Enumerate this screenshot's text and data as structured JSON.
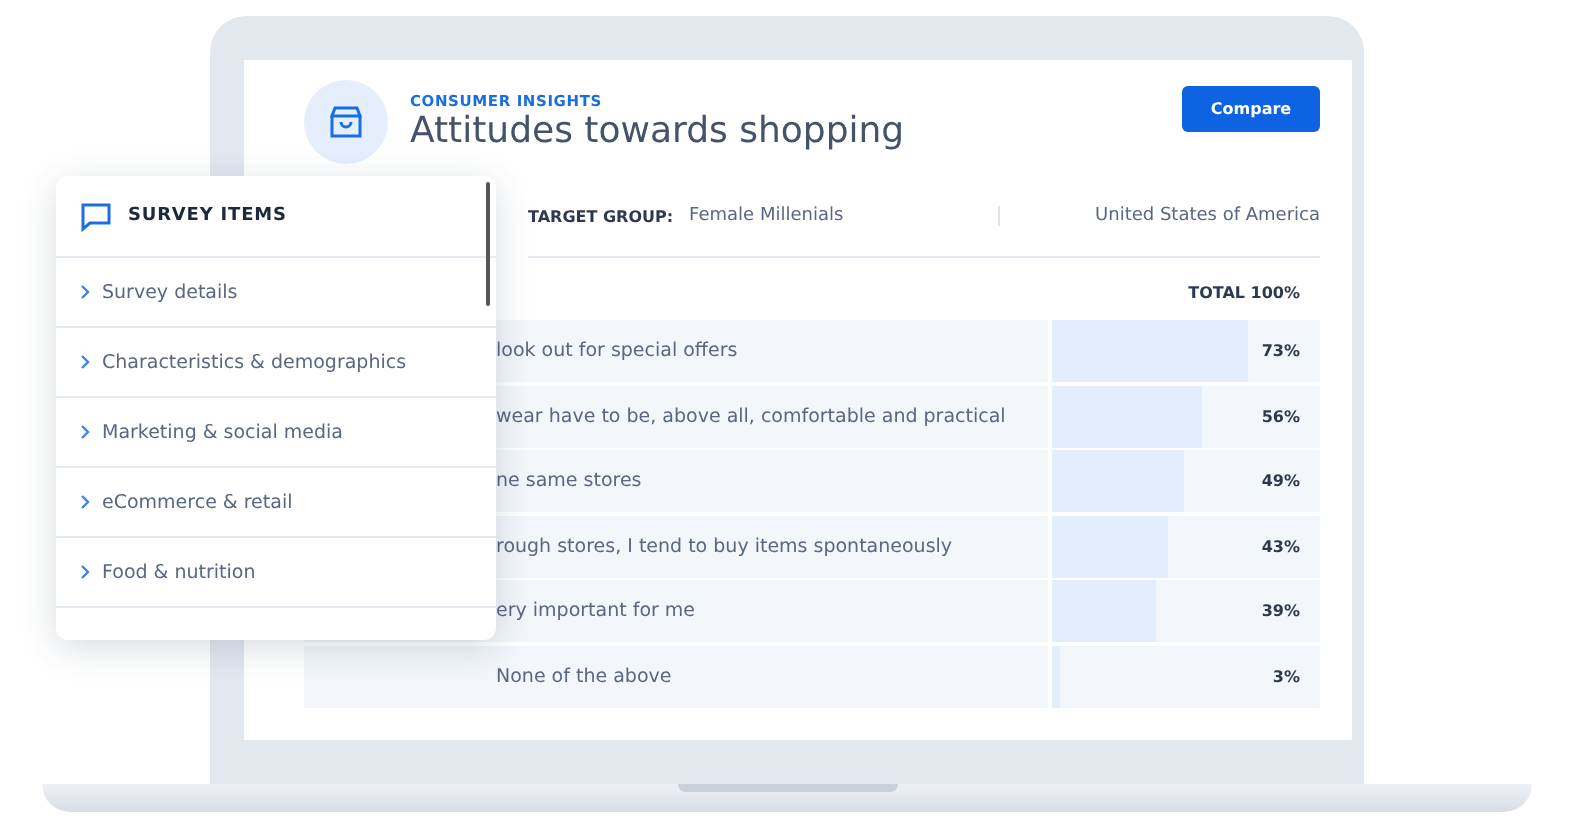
{
  "header": {
    "eyebrow": "CONSUMER INSIGHTS",
    "title": "Attitudes towards shopping",
    "button": "Compare"
  },
  "filters": {
    "label": "TARGET GROUP:",
    "value": "Female Millenials",
    "country": "United States of America"
  },
  "table": {
    "total": "TOTAL 100%",
    "rows": [
      {
        "label": "look out for special offers",
        "level": 0.73,
        "value": "73%"
      },
      {
        "label": "wear have to be, above all, comfortable and practical",
        "level": 0.56,
        "value": "56%"
      },
      {
        "label": "ne same stores",
        "level": 0.49,
        "value": "49%"
      },
      {
        "label": "rough stores, I tend to buy items spontaneously",
        "level": 0.43,
        "value": "43%"
      },
      {
        "label": "ery important for me",
        "level": 0.39,
        "value": "39%"
      },
      {
        "label": "None of the above",
        "level": 0.03,
        "value": "3%"
      }
    ]
  },
  "panel": {
    "title": "SURVEY ITEMS",
    "items": [
      "Survey details",
      "Characteristics & demographics",
      "Marketing & social media",
      "eCommerce & retail",
      "Food & nutrition"
    ]
  }
}
